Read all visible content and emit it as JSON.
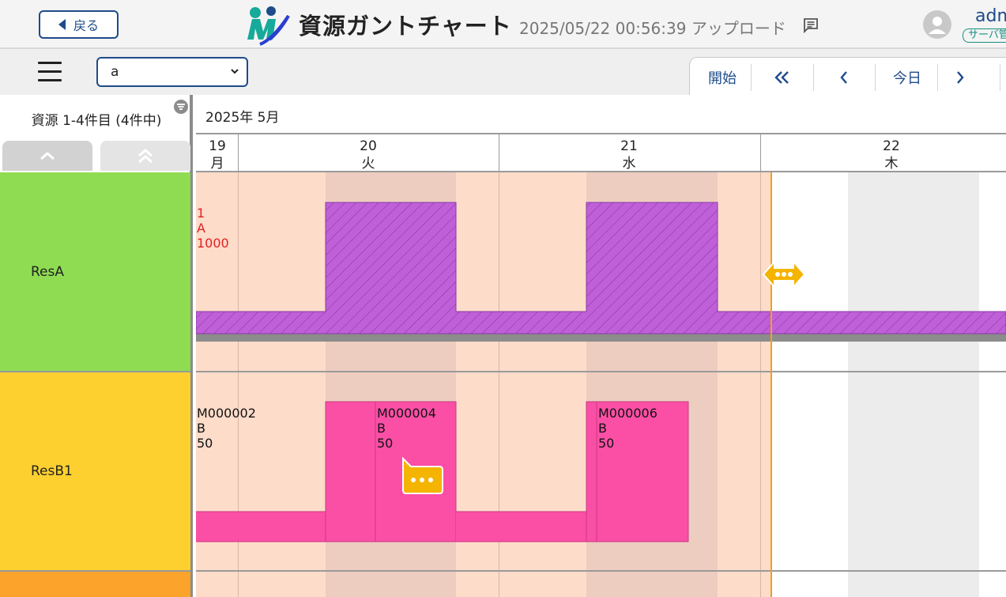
{
  "header": {
    "back_label": "戻る",
    "title": "資源ガントチャート",
    "upload_time": "2025/05/22 00:56:39",
    "upload_label": "アップロード",
    "user_name": "adm",
    "user_role": "サーバ管"
  },
  "toolbar": {
    "select_value": "a",
    "nav": {
      "start_label": "開始",
      "today_label": "今日"
    }
  },
  "left_panel": {
    "resource_count": "資源 1-4件目 (4件中)",
    "resources": [
      {
        "name": "ResA",
        "color": "#8fdc52"
      },
      {
        "name": "ResB1",
        "color": "#fdd02f"
      },
      {
        "name": "",
        "color": "#fba32a"
      }
    ]
  },
  "gantt": {
    "month": "2025年 5月",
    "days": [
      {
        "num": "19",
        "weekday": "月"
      },
      {
        "num": "20",
        "weekday": "火"
      },
      {
        "num": "21",
        "weekday": "水"
      },
      {
        "num": "22",
        "weekday": "木"
      }
    ],
    "resA_label": [
      "1",
      "A",
      "1000"
    ],
    "resB_tasks": [
      {
        "id": "M000002",
        "item": "B",
        "qty": "50"
      },
      {
        "id": "M000004",
        "item": "B",
        "qty": "50"
      },
      {
        "id": "M000006",
        "item": "B",
        "qty": "50"
      }
    ]
  },
  "colors": {
    "accent": "#1e4b8a",
    "past_bg": "#fddcca",
    "night_bg": "#edcdc0",
    "purple_bar": "#c060d8",
    "pink_bar": "#fb4fa6",
    "now_line": "#f0a020",
    "bubble": "#f4b400"
  }
}
